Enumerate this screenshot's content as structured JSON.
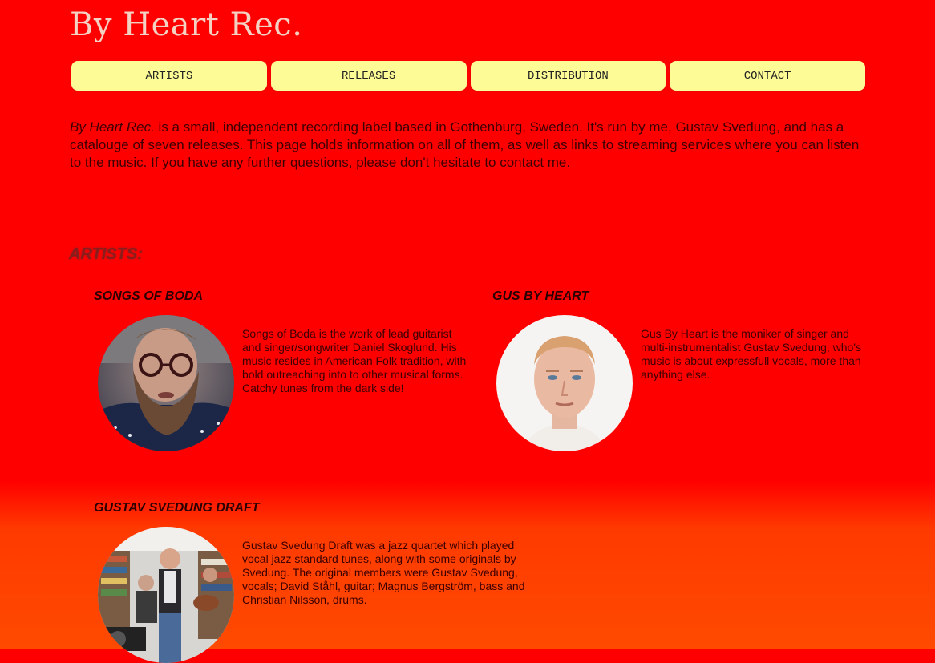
{
  "site": {
    "title": "By Heart Rec."
  },
  "nav": {
    "items": [
      {
        "label": "ARTISTS"
      },
      {
        "label": "RELEASES"
      },
      {
        "label": "DISTRIBUTION"
      },
      {
        "label": "CONTACT"
      }
    ]
  },
  "intro": {
    "label_italic": "By Heart Rec.",
    "text": " is a small, independent recording label based in Gothenburg, Sweden. It's run by me, Gustav Svedung, and has a catalouge of seven releases. This page holds information on all of them, as well as links to streaming services where you can listen to the music. If you have any further questions, please don't hesitate to contact me."
  },
  "artists_section": {
    "heading": "ARTISTS:",
    "items": [
      {
        "name": "SONGS OF BODA",
        "description": "Songs of Boda is the work of lead guitarist and singer/songwriter Daniel Skoglund. His music resides in American Folk tradition, with bold outreaching into to other musical forms. Catchy tunes from the dark side!"
      },
      {
        "name": "GUS BY HEART",
        "description": "Gus By Heart is the moniker of singer and multi-instrumentalist Gustav Svedung, who's music is about expressfull vocals, more than anything else."
      },
      {
        "name": "GUSTAV SVEDUNG DRAFT",
        "description": "Gustav Svedung Draft was a jazz quartet which played vocal jazz standard tunes, along with some originals by Svedung. The original members were Gustav Svedung, vocals; David Ståhl, guitar; Magnus Bergström, bass and Christian Nilsson, drums."
      }
    ]
  },
  "colors": {
    "background": "#ff0000",
    "nav_button": "#fcfb96",
    "title": "#f3d2c4"
  }
}
